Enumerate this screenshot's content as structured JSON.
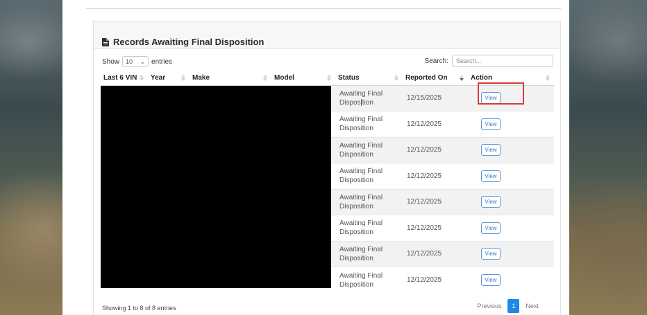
{
  "card": {
    "title": "Records Awaiting Final Disposition",
    "title_icon": "document-icon"
  },
  "controls": {
    "show_label": "Show",
    "entries_label": "entries",
    "page_length": "10",
    "search_label": "Search:",
    "search_placeholder": "Search..."
  },
  "table": {
    "columns": [
      "Last 6 VIN",
      "Year",
      "Make",
      "Model",
      "Status",
      "Reported On",
      "Action"
    ],
    "rows": [
      {
        "status": "Awaiting Final Disposition",
        "reported_on": "12/15/2025",
        "action": "View"
      },
      {
        "status": "Awaiting Final Disposition",
        "reported_on": "12/12/2025",
        "action": "View"
      },
      {
        "status": "Awaiting Final Disposition",
        "reported_on": "12/12/2025",
        "action": "View"
      },
      {
        "status": "Awaiting Final Disposition",
        "reported_on": "12/12/2025",
        "action": "View"
      },
      {
        "status": "Awaiting Final Disposition",
        "reported_on": "12/12/2025",
        "action": "View"
      },
      {
        "status": "Awaiting Final Disposition",
        "reported_on": "12/12/2025",
        "action": "View"
      },
      {
        "status": "Awaiting Final Disposition",
        "reported_on": "12/12/2025",
        "action": "View"
      },
      {
        "status": "Awaiting Final Disposition",
        "reported_on": "12/12/2025",
        "action": "View"
      }
    ]
  },
  "footer": {
    "info": "Showing 1 to 8 of 8 entries",
    "previous": "Previous",
    "current_page": "1",
    "next": "Next"
  },
  "colors": {
    "highlight": "#d83a3a",
    "accent": "#1e88e5"
  }
}
